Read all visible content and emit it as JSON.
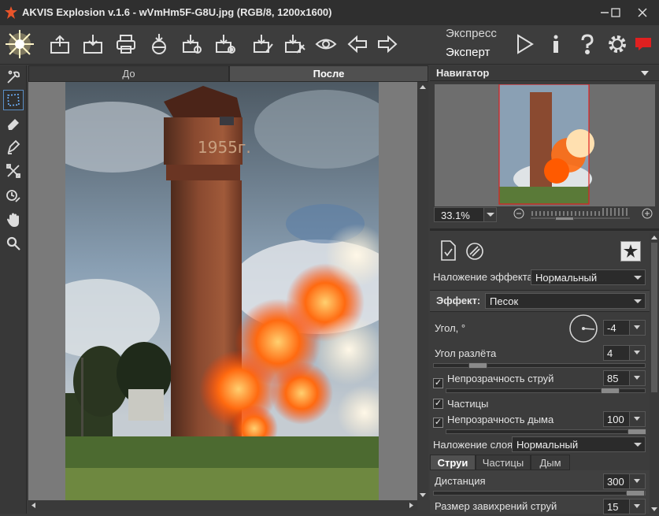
{
  "window": {
    "title": "AKVIS Explosion v.1.6 - wVmHm5F-G8U.jpg (RGB/8, 1200x1600)"
  },
  "toolbar": {
    "mode_express": "Экспресс",
    "mode_expert": "Эксперт"
  },
  "canvas_tabs": {
    "before": "До",
    "after": "После"
  },
  "photo": {
    "tower_inscription": "1955г."
  },
  "navigator": {
    "title": "Навигатор",
    "zoom": "33.1%",
    "zoom_level": 0.3
  },
  "settings": {
    "effect_blend_label": "Наложение эффекта",
    "effect_blend_value": "Нормальный",
    "effect_label": "Эффект:",
    "effect_value": "Песок",
    "angle_label": "Угол, °",
    "angle_value": "-4",
    "spread_label": "Угол разлёта",
    "spread_value": "4",
    "spread_level": 0.18,
    "stream_opacity_label": "Непрозрачность струй",
    "stream_opacity_value": "85",
    "stream_opacity_checked": true,
    "particles_label": "Частицы",
    "particles_checked": true,
    "smoke_opacity_label": "Непрозрачность дыма",
    "smoke_opacity_value": "100",
    "smoke_opacity_checked": true,
    "layer_blend_label": "Наложение слоя",
    "layer_blend_value": "Нормальный"
  },
  "subtabs": {
    "streams": "Струи",
    "particles": "Частицы",
    "smoke": "Дым"
  },
  "streams": {
    "distance_label": "Дистанция",
    "distance_value": "300",
    "swirl_label": "Размер завихрений струй",
    "swirl_value": "15"
  },
  "colors": {
    "accent": "#5a8ec4",
    "close_red": "#e02020"
  }
}
